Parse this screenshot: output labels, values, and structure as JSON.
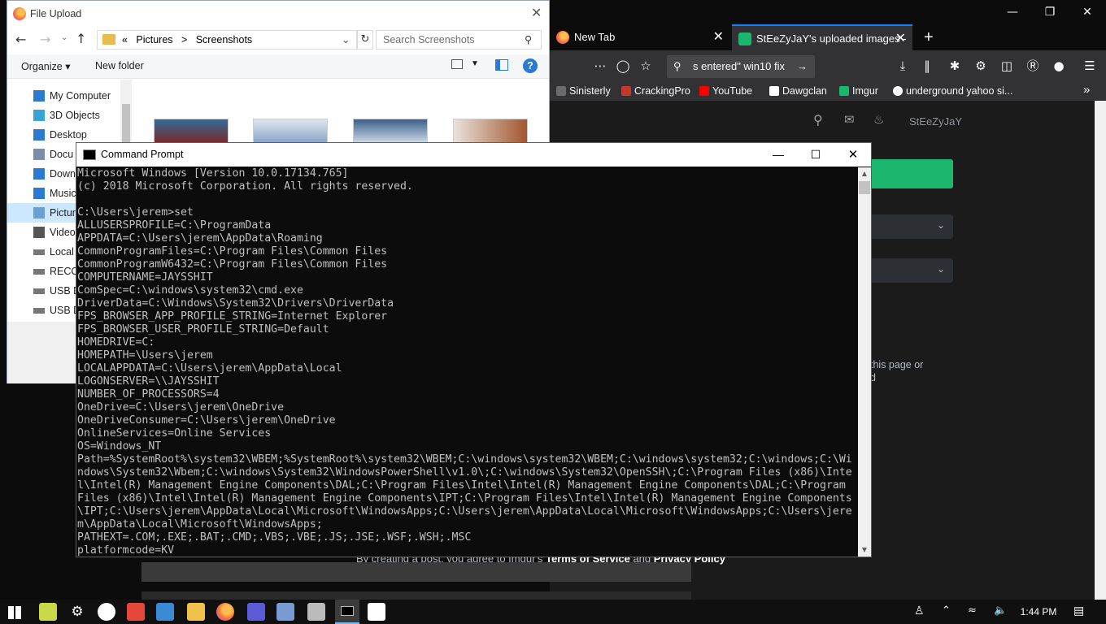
{
  "browser": {
    "tabs": [
      {
        "label": "New Tab",
        "close": "✕"
      },
      {
        "label": "StEeZyJaY's uploaded images -",
        "close": "✕"
      }
    ],
    "new_tab": "+",
    "url_text": "s entered\" win10 fix",
    "bookmarks": [
      {
        "label": "Sinisterly",
        "color": "#6b6b6b"
      },
      {
        "label": "CrackingPro",
        "color": "#c0392b"
      },
      {
        "label": "YouTube",
        "color": "#ff0000"
      },
      {
        "label": "Dawgclan",
        "color": "#ffffff"
      },
      {
        "label": "Imgur",
        "color": "#1bb76e"
      },
      {
        "label": "underground yahoo si...",
        "color": "#ffffff"
      }
    ],
    "page": {
      "username": "StEeZyJaY",
      "side_text_1": "this page or",
      "side_text_2": "d",
      "footer_prefix": "By creating a post, you agree to Imgur's",
      "footer_terms": "Terms of Service",
      "footer_and": "and",
      "footer_privacy": "Privacy Policy"
    },
    "accent": "#0a84ff"
  },
  "dialog": {
    "title": "File Upload",
    "breadcrumb": [
      "«",
      "Pictures",
      ">",
      "Screenshots"
    ],
    "search_placeholder": "Search Screenshots",
    "organize": "Organize ▾",
    "new_folder": "New folder",
    "nav_items": [
      {
        "label": "My Computer",
        "icon": "computer-icon",
        "color": "#2b79d0"
      },
      {
        "label": "3D Objects",
        "icon": "cube-icon",
        "color": "#38a3d6"
      },
      {
        "label": "Desktop",
        "icon": "desktop-icon",
        "color": "#2b79d0"
      },
      {
        "label": "Docu",
        "icon": "document-icon",
        "color": "#7a8ea8"
      },
      {
        "label": "Down",
        "icon": "download-icon",
        "color": "#2b79d0"
      },
      {
        "label": "Music",
        "icon": "music-icon",
        "color": "#2b79d0"
      },
      {
        "label": "Pictur",
        "icon": "pictures-icon",
        "color": "#6aa0d6"
      },
      {
        "label": "Videos",
        "icon": "video-icon",
        "color": "#555"
      },
      {
        "label": "Local",
        "icon": "drive-icon",
        "color": "#777"
      },
      {
        "label": "RECO",
        "icon": "drive-icon",
        "color": "#777"
      },
      {
        "label": "USB D",
        "icon": "usb-drive-icon",
        "color": "#777"
      },
      {
        "label": "USB D",
        "icon": "usb-drive-icon",
        "color": "#777"
      }
    ]
  },
  "cmd": {
    "title": "Command Prompt",
    "lines": [
      "Microsoft Windows [Version 10.0.17134.765]",
      "(c) 2018 Microsoft Corporation. All rights reserved.",
      "",
      "C:\\Users\\jerem>set",
      "ALLUSERSPROFILE=C:\\ProgramData",
      "APPDATA=C:\\Users\\jerem\\AppData\\Roaming",
      "CommonProgramFiles=C:\\Program Files\\Common Files",
      "CommonProgramW6432=C:\\Program Files\\Common Files",
      "COMPUTERNAME=JAYSSHIT",
      "ComSpec=C:\\windows\\system32\\cmd.exe",
      "DriverData=C:\\Windows\\System32\\Drivers\\DriverData",
      "FPS_BROWSER_APP_PROFILE_STRING=Internet Explorer",
      "FPS_BROWSER_USER_PROFILE_STRING=Default",
      "HOMEDRIVE=C:",
      "HOMEPATH=\\Users\\jerem",
      "LOCALAPPDATA=C:\\Users\\jerem\\AppData\\Local",
      "LOGONSERVER=\\\\JAYSSHIT",
      "NUMBER_OF_PROCESSORS=4",
      "OneDrive=C:\\Users\\jerem\\OneDrive",
      "OneDriveConsumer=C:\\Users\\jerem\\OneDrive",
      "OnlineServices=Online Services",
      "OS=Windows_NT",
      "Path=%SystemRoot%\\system32\\WBEM;%SystemRoot%\\system32\\WBEM;C:\\windows\\system32\\WBEM;C:\\windows\\system32;C:\\windows;C:\\Wi",
      "ndows\\System32\\Wbem;C:\\windows\\System32\\WindowsPowerShell\\v1.0\\;C:\\windows\\System32\\OpenSSH\\;C:\\Program Files (x86)\\Inte",
      "l\\Intel(R) Management Engine Components\\DAL;C:\\Program Files\\Intel\\Intel(R) Management Engine Components\\DAL;C:\\Program",
      "Files (x86)\\Intel\\Intel(R) Management Engine Components\\IPT;C:\\Program Files\\Intel\\Intel(R) Management Engine Components",
      "\\IPT;C:\\Users\\jerem\\AppData\\Local\\Microsoft\\WindowsApps;C:\\Users\\jerem\\AppData\\Local\\Microsoft\\WindowsApps;C:\\Users\\jere",
      "m\\AppData\\Local\\Microsoft\\WindowsApps;",
      "PATHEXT=.COM;.EXE;.BAT;.CMD;.VBS;.VBE;.JS;.JSE;.WSF;.WSH;.MSC",
      "platformcode=KV"
    ]
  },
  "taskbar": {
    "clock": "1:44 PM"
  }
}
